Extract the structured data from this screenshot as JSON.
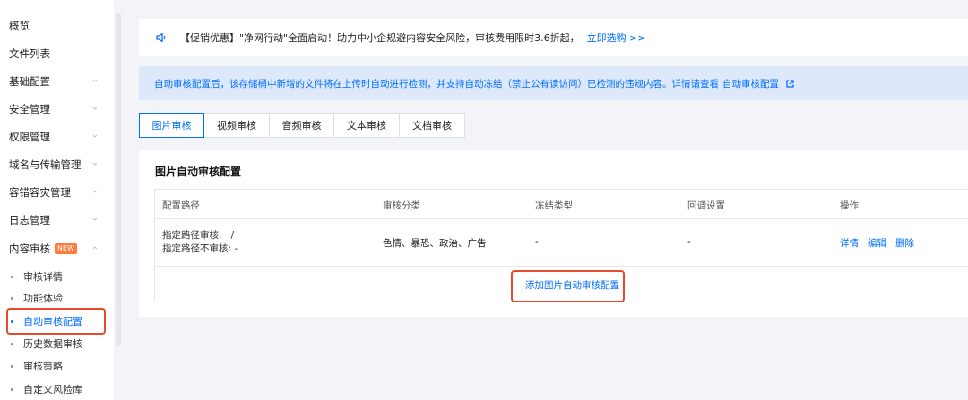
{
  "sidebar": {
    "items": [
      {
        "label": "概览",
        "has_chevron": false
      },
      {
        "label": "文件列表",
        "has_chevron": false
      },
      {
        "label": "基础配置",
        "has_chevron": true
      },
      {
        "label": "安全管理",
        "has_chevron": true
      },
      {
        "label": "权限管理",
        "has_chevron": true
      },
      {
        "label": "域名与传输管理",
        "has_chevron": true
      },
      {
        "label": "容错容灾管理",
        "has_chevron": true
      },
      {
        "label": "日志管理",
        "has_chevron": true
      },
      {
        "label": "内容审核",
        "badge": "NEW",
        "has_chevron": true,
        "expanded": true
      }
    ],
    "sub_items": [
      {
        "label": "审核详情"
      },
      {
        "label": "功能体验"
      },
      {
        "label": "自动审核配置",
        "active": true
      },
      {
        "label": "历史数据审核"
      },
      {
        "label": "审核策略"
      },
      {
        "label": "自定义风险库"
      }
    ]
  },
  "notice": {
    "text": "【促销优惠】\"净网行动\"全面启动！助力中小企规避内容安全风险，审核费用限时3.6折起，",
    "link": "立即选购 >>"
  },
  "info_bar": {
    "text": "自动审核配置后，该存储桶中新增的文件将在上传时自动进行检测，并支持自动冻结（禁止公有读访问）已检测的违规内容。详情请查看",
    "link": "自动审核配置"
  },
  "tabs": [
    {
      "label": "图片审核",
      "active": true
    },
    {
      "label": "视频审核"
    },
    {
      "label": "音频审核"
    },
    {
      "label": "文本审核"
    },
    {
      "label": "文档审核"
    }
  ],
  "card": {
    "title": "图片自动审核配置",
    "columns": [
      "配置路径",
      "审核分类",
      "冻结类型",
      "回调设置",
      "操作"
    ],
    "rows": [
      {
        "path_include_label": "指定路径审核:",
        "path_include_value": "/",
        "path_exclude_label": "指定路径不审核:",
        "path_exclude_value": "-",
        "category": "色情、暴恐、政治、广告",
        "freeze": "-",
        "callback": "-",
        "actions": [
          "详情",
          "编辑",
          "删除"
        ]
      }
    ],
    "add_label": "添加图片自动审核配置"
  },
  "colors": {
    "accent": "#006eff",
    "highlight": "#e84a2c",
    "badge": "#ff7a3d",
    "info_bg": "#dde9fb"
  }
}
